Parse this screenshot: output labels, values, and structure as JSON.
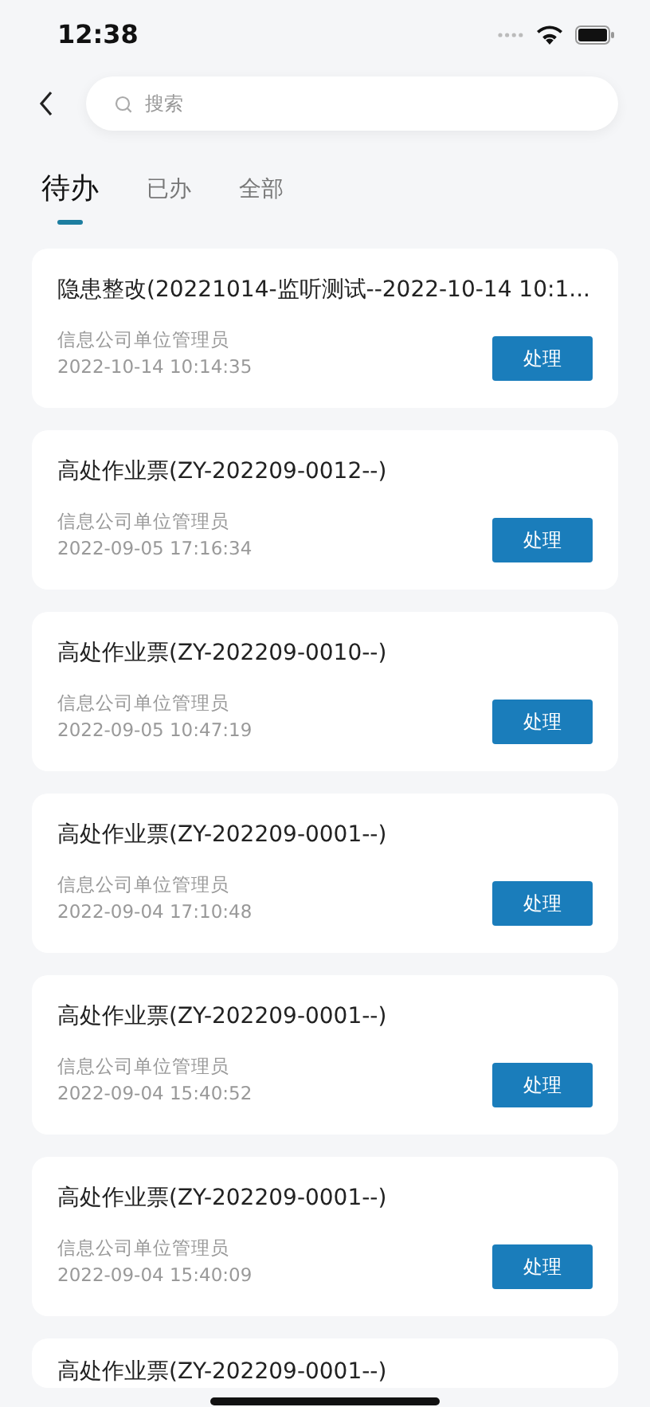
{
  "status_bar": {
    "time": "12:38"
  },
  "search": {
    "placeholder": "搜索"
  },
  "tabs": [
    {
      "label": "待办",
      "selected": true
    },
    {
      "label": "已办",
      "selected": false
    },
    {
      "label": "全部",
      "selected": false
    }
  ],
  "items": [
    {
      "title": "隐患整改(20221014-监听测试--2022-10-14 10:1...",
      "unit": "信息公司单位管理员",
      "time": "2022-10-14 10:14:35",
      "action": "处理"
    },
    {
      "title": "高处作业票(ZY-202209-0012--)",
      "unit": "信息公司单位管理员",
      "time": "2022-09-05 17:16:34",
      "action": "处理"
    },
    {
      "title": "高处作业票(ZY-202209-0010--)",
      "unit": "信息公司单位管理员",
      "time": "2022-09-05 10:47:19",
      "action": "处理"
    },
    {
      "title": "高处作业票(ZY-202209-0001--)",
      "unit": "信息公司单位管理员",
      "time": "2022-09-04 17:10:48",
      "action": "处理"
    },
    {
      "title": "高处作业票(ZY-202209-0001--)",
      "unit": "信息公司单位管理员",
      "time": "2022-09-04 15:40:52",
      "action": "处理"
    },
    {
      "title": "高处作业票(ZY-202209-0001--)",
      "unit": "信息公司单位管理员",
      "time": "2022-09-04 15:40:09",
      "action": "处理"
    },
    {
      "title": "高处作业票(ZY-202209-0001--)"
    }
  ]
}
